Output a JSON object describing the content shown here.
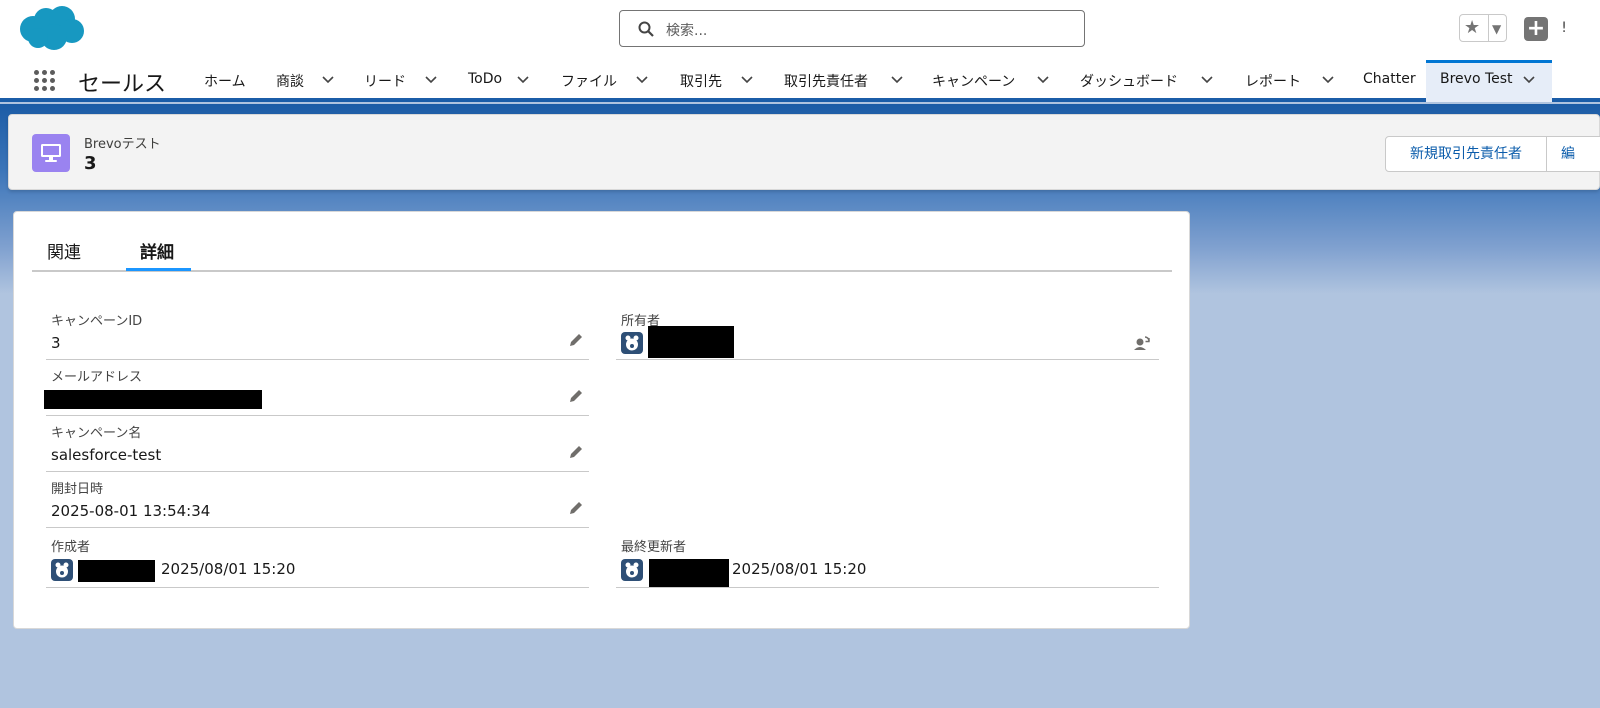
{
  "header": {
    "search_placeholder": "検索...",
    "edge_char": "ǃ"
  },
  "nav": {
    "app_name": "セールス",
    "items": [
      {
        "label": "ホーム",
        "has_menu": false
      },
      {
        "label": "商談",
        "has_menu": true
      },
      {
        "label": "リード",
        "has_menu": true
      },
      {
        "label": "ToDo",
        "has_menu": true
      },
      {
        "label": "ファイル",
        "has_menu": true
      },
      {
        "label": "取引先",
        "has_menu": true
      },
      {
        "label": "取引先責任者",
        "has_menu": true
      },
      {
        "label": "キャンペーン",
        "has_menu": true
      },
      {
        "label": "ダッシュボード",
        "has_menu": true
      },
      {
        "label": "レポート",
        "has_menu": true
      },
      {
        "label": "Chatter",
        "has_menu": false
      },
      {
        "label": "Brevo Test",
        "has_menu": true,
        "active": true
      }
    ]
  },
  "record": {
    "object_type": "Brevoテスト",
    "title": "3",
    "actions": {
      "new_contact": "新規取引先責任者",
      "next_partial": "編"
    }
  },
  "tabs": [
    {
      "label": "関連",
      "selected": false
    },
    {
      "label": "詳細",
      "selected": true
    }
  ],
  "fields": {
    "campaign_id": {
      "label": "キャンペーンID",
      "value": "3"
    },
    "owner": {
      "label": "所有者"
    },
    "email": {
      "label": "メールアドレス"
    },
    "campaign_name": {
      "label": "キャンペーン名",
      "value": "salesforce-test"
    },
    "opened_at": {
      "label": "開封日時",
      "value": "2025-08-01 13:54:34"
    },
    "created_by": {
      "label": "作成者",
      "date": "2025/08/01 15:20"
    },
    "last_modified_by": {
      "label": "最終更新者",
      "date": "2025/08/01 15:20"
    }
  },
  "colors": {
    "brand": "#0176d3",
    "nav_border": "#1b5da8",
    "record_icon": "#9a83f0",
    "tab_underline": "#1b96ff"
  },
  "icons": [
    "salesforce-cloud-icon",
    "search-icon",
    "star-icon",
    "caret-icon",
    "plus-icon",
    "app-launcher-icon",
    "chevron-down-icon",
    "record-type-icon",
    "edit-icon",
    "change-owner-icon",
    "user-avatar-icon"
  ]
}
